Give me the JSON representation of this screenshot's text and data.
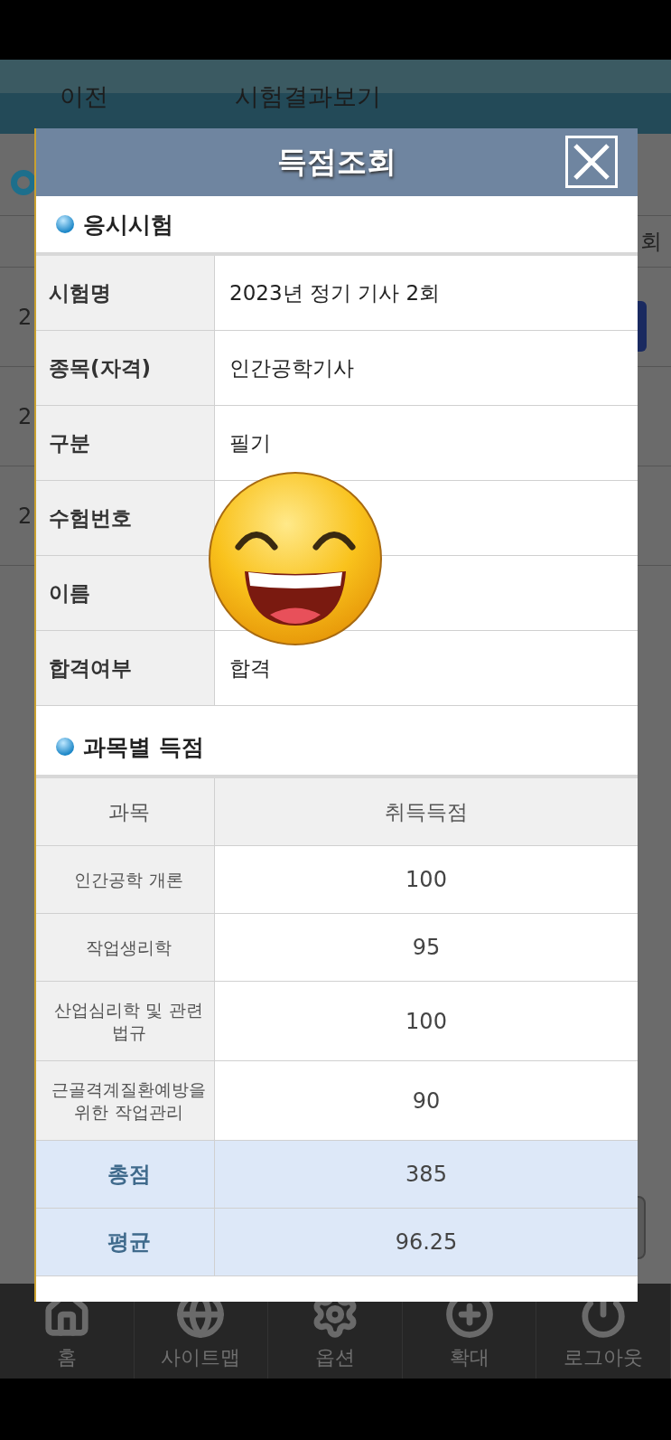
{
  "header": {
    "back": "이전",
    "title": "시험결과보기"
  },
  "background": {
    "column_header": "회",
    "rows": [
      {
        "column_1": "2"
      },
      {
        "column_1": "2"
      },
      {
        "column_1": "2"
      }
    ]
  },
  "dialog": {
    "title": "득점조회",
    "exam_section": {
      "heading": "응시시험",
      "rows": [
        {
          "label": "시험명",
          "value": "2023년 정기 기사 2회"
        },
        {
          "label": "종목(자격)",
          "value": "인간공학기사"
        },
        {
          "label": "구분",
          "value": "필기"
        },
        {
          "label": "수험번호"
        },
        {
          "label": "이름"
        },
        {
          "label": "합격여부",
          "value": "합격"
        }
      ]
    },
    "score_section": {
      "heading": "과목별 득점",
      "columns": [
        "과목",
        "취득득점"
      ],
      "rows": [
        {
          "subject": "인간공학 개론",
          "score": "100"
        },
        {
          "subject": "작업생리학",
          "score": "95"
        },
        {
          "subject": "산업심리학 및 관련 법규",
          "score": "100"
        },
        {
          "subject": "근골격계질환예방을 위한 작업관리",
          "score": "90"
        }
      ],
      "totals": [
        {
          "label": "총점",
          "value": "385"
        },
        {
          "label": "평균",
          "value": "96.25"
        }
      ]
    }
  },
  "bottom_nav": [
    {
      "label": "홈"
    },
    {
      "label": "사이트맵"
    },
    {
      "label": "옵션"
    },
    {
      "label": "확대"
    },
    {
      "label": "로그아웃"
    }
  ]
}
